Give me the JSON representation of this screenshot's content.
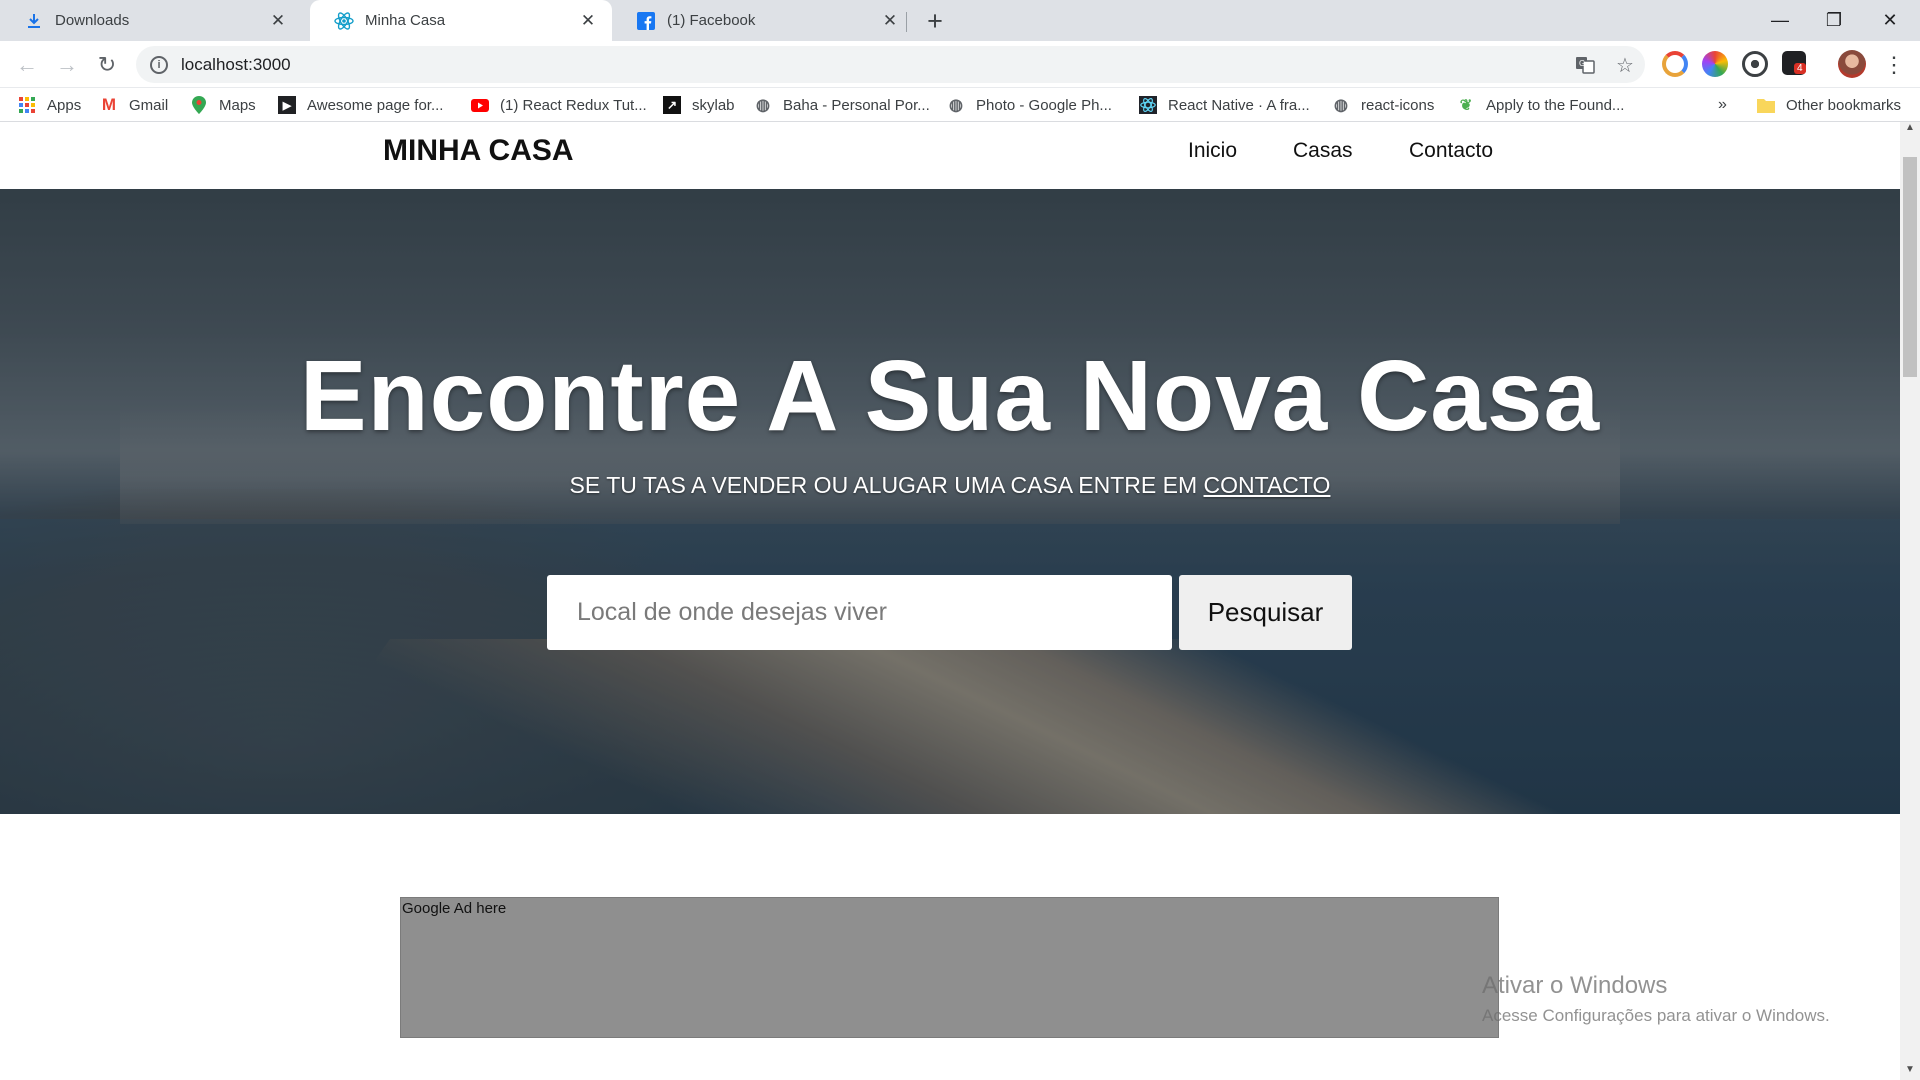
{
  "browser": {
    "tabs": [
      {
        "title": "Downloads",
        "icon": "download-icon"
      },
      {
        "title": "Minha Casa",
        "icon": "react-icon",
        "active": true
      },
      {
        "title": "(1) Facebook",
        "icon": "facebook-icon"
      }
    ],
    "url": "localhost:3000",
    "bookmarks": [
      {
        "label": "Apps",
        "icon": "apps-grid-icon"
      },
      {
        "label": "Gmail",
        "icon": "gmail-icon"
      },
      {
        "label": "Maps",
        "icon": "maps-icon"
      },
      {
        "label": "Awesome page for...",
        "icon": "bookmark-page-icon"
      },
      {
        "label": "(1) React Redux Tut...",
        "icon": "youtube-icon"
      },
      {
        "label": "skylab",
        "icon": "skylab-icon"
      },
      {
        "label": "Baha - Personal Por...",
        "icon": "globe-icon"
      },
      {
        "label": "Photo - Google Ph...",
        "icon": "globe-icon"
      },
      {
        "label": "React Native · A fra...",
        "icon": "react-icon"
      },
      {
        "label": "react-icons",
        "icon": "globe-icon"
      },
      {
        "label": "Apply to the Found...",
        "icon": "leaf-icon"
      }
    ],
    "overflow_label": "»",
    "other_bookmarks": "Other bookmarks",
    "extension_badge": "4"
  },
  "site": {
    "brand": "MINHA CASA",
    "nav": [
      "Inicio",
      "Casas",
      "Contacto"
    ],
    "hero": {
      "title": "Encontre A Sua Nova Casa",
      "subtitle": "SE TU TAS A VENDER OU ALUGAR UMA CASA ENTRE EM",
      "subtitle_link": "CONTACTO"
    },
    "search": {
      "placeholder": "Local de onde desejas viver",
      "button": "Pesquisar"
    },
    "ad": "Google Ad here"
  },
  "watermark": {
    "title": "Ativar o Windows",
    "subtitle": "Acesse Configurações para ativar o Windows."
  }
}
